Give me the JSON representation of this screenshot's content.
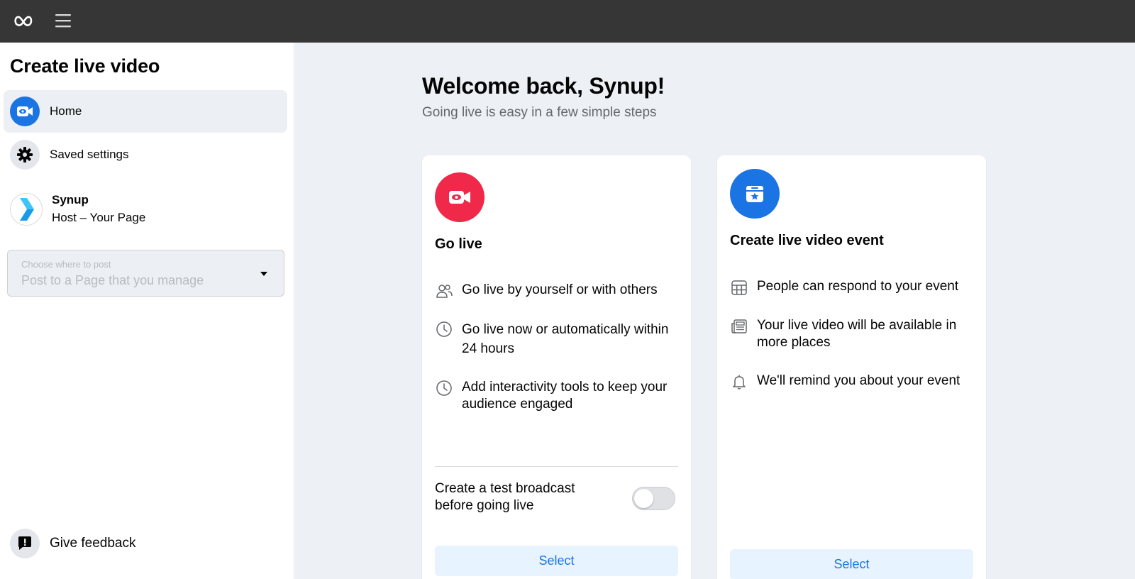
{
  "topbar": {
    "logo_icon": "meta-logo-icon",
    "menu_icon": "hamburger-menu-icon"
  },
  "sidebar": {
    "title": "Create live video",
    "items": [
      {
        "label": "Home",
        "icon": "live-video-camera-icon",
        "active": true
      },
      {
        "label": "Saved settings",
        "icon": "gear-icon",
        "active": false
      }
    ],
    "page": {
      "name": "Synup",
      "role": "Host – Your Page"
    },
    "post_select": {
      "label": "Choose where to post",
      "value": "Post to a Page that you manage"
    },
    "feedback_label": "Give feedback"
  },
  "main": {
    "welcome_title": "Welcome back, Synup!",
    "welcome_subtitle": "Going live is easy in a few simple steps",
    "go_live_card": {
      "title": "Go live",
      "features": [
        {
          "text": "Go live by yourself or with others",
          "icon": "people-icon"
        },
        {
          "text": "Go live now or automatically within 24 hours",
          "icon": "clock-icon"
        },
        {
          "text": "Add interactivity tools to keep your audience engaged",
          "icon": "clock-icon"
        }
      ],
      "test_broadcast_label": "Create a test broadcast before going live",
      "test_broadcast_enabled": false,
      "select_label": "Select"
    },
    "event_card": {
      "title": "Create live video event",
      "features": [
        {
          "text": "People can respond to your event",
          "icon": "calendar-grid-icon"
        },
        {
          "text": "Your live video will be available in more places",
          "icon": "newspaper-icon"
        },
        {
          "text": "We'll remind you about your event",
          "icon": "bell-icon"
        }
      ],
      "select_label": "Select"
    }
  },
  "colors": {
    "topbar": "#363636",
    "accent_blue": "#1b74e4",
    "accent_red": "#f02849",
    "main_bg": "#edf0f4"
  }
}
